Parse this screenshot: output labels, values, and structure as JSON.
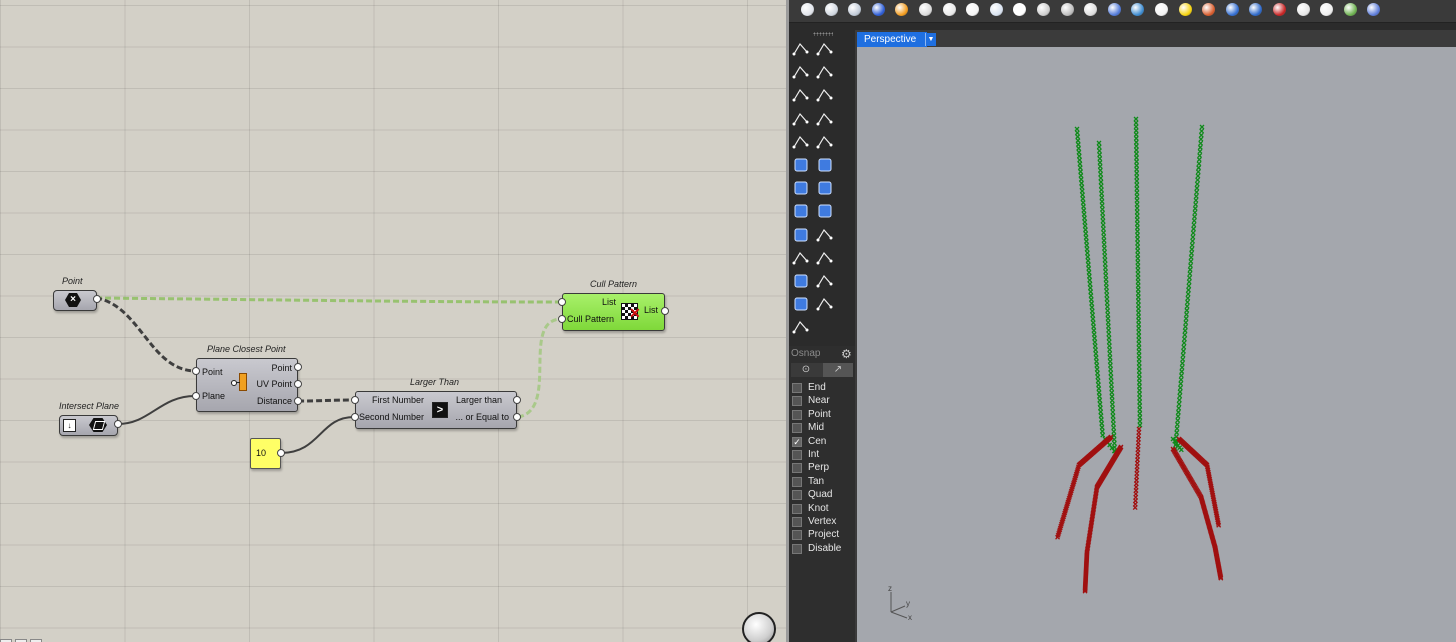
{
  "grasshopper": {
    "components": {
      "point": {
        "title": "Point"
      },
      "plane_closest_point": {
        "title": "Plane Closest Point",
        "inputs": [
          "Point",
          "Plane"
        ],
        "outputs": [
          "Point",
          "UV Point",
          "Distance"
        ]
      },
      "intersect_plane": {
        "title": "Intersect Plane"
      },
      "larger_than": {
        "title": "Larger Than",
        "inputs": [
          "First Number",
          "Second Number"
        ],
        "outputs": [
          "Larger than",
          "... or Equal to"
        ],
        "symbol": ">"
      },
      "number_panel": {
        "value": "10"
      },
      "cull_pattern": {
        "title": "Cull Pattern",
        "inputs": [
          "List",
          "Cull Pattern"
        ],
        "outputs": [
          "List"
        ]
      }
    },
    "colors": {
      "canvas": "#d3d0c7",
      "component": "#b5b5bc",
      "active": "#8fe34f",
      "panel": "#ffff66",
      "wire_preview": "#8dc060"
    }
  },
  "rhino": {
    "viewport": {
      "name": "Perspective",
      "axis_labels": {
        "z": "z",
        "y": "y",
        "x": "x"
      }
    },
    "osnap": {
      "title": "Osnap",
      "items": [
        {
          "label": "End",
          "checked": false
        },
        {
          "label": "Near",
          "checked": false
        },
        {
          "label": "Point",
          "checked": false
        },
        {
          "label": "Mid",
          "checked": false
        },
        {
          "label": "Cen",
          "checked": true
        },
        {
          "label": "Int",
          "checked": false
        },
        {
          "label": "Perp",
          "checked": false
        },
        {
          "label": "Tan",
          "checked": false
        },
        {
          "label": "Quad",
          "checked": false
        },
        {
          "label": "Knot",
          "checked": false
        },
        {
          "label": "Vertex",
          "checked": false
        },
        {
          "label": "Project",
          "checked": false
        },
        {
          "label": "Disable",
          "checked": false
        }
      ]
    },
    "colors": {
      "viewport_bg": "#a4a7ad",
      "tab": "#1f6fe0",
      "points_kept": "#0f8a1a",
      "points_culled": "#a01010"
    },
    "top_toolbar_icons": [
      "wireframe-icon",
      "shaded-icon",
      "rendered-icon",
      "blue-sphere-icon",
      "orange-sphere-icon",
      "ghosted-icon",
      "xray-icon",
      "technical-icon",
      "artistic-icon",
      "pen-icon",
      "light-icon",
      "light2-icon",
      "light3-icon",
      "material-icon",
      "environment-icon",
      "white-ball-icon",
      "yellow-ball-icon",
      "analysis-icon",
      "render-icon",
      "render-window-icon",
      "close-render-icon",
      "display-icon",
      "box-icon",
      "layers-icon",
      "grid-icon"
    ],
    "side_toolbar_icons": [
      "select-icon",
      "point-icon",
      "polyline-icon",
      "curve-icon",
      "circle-icon",
      "arc-icon",
      "ellipse-icon",
      "rectangle-icon",
      "polygon-icon",
      "fillet-icon",
      "surface-icon",
      "extrude-icon",
      "box-solid-icon",
      "sphere-solid-icon",
      "cylinder-icon",
      "mesh-icon",
      "transform-icon",
      "explode-icon",
      "split-icon",
      "trim-icon",
      "boolean-icon",
      "group-icon",
      "text-icon",
      "dimension-icon",
      "more-icon"
    ]
  }
}
